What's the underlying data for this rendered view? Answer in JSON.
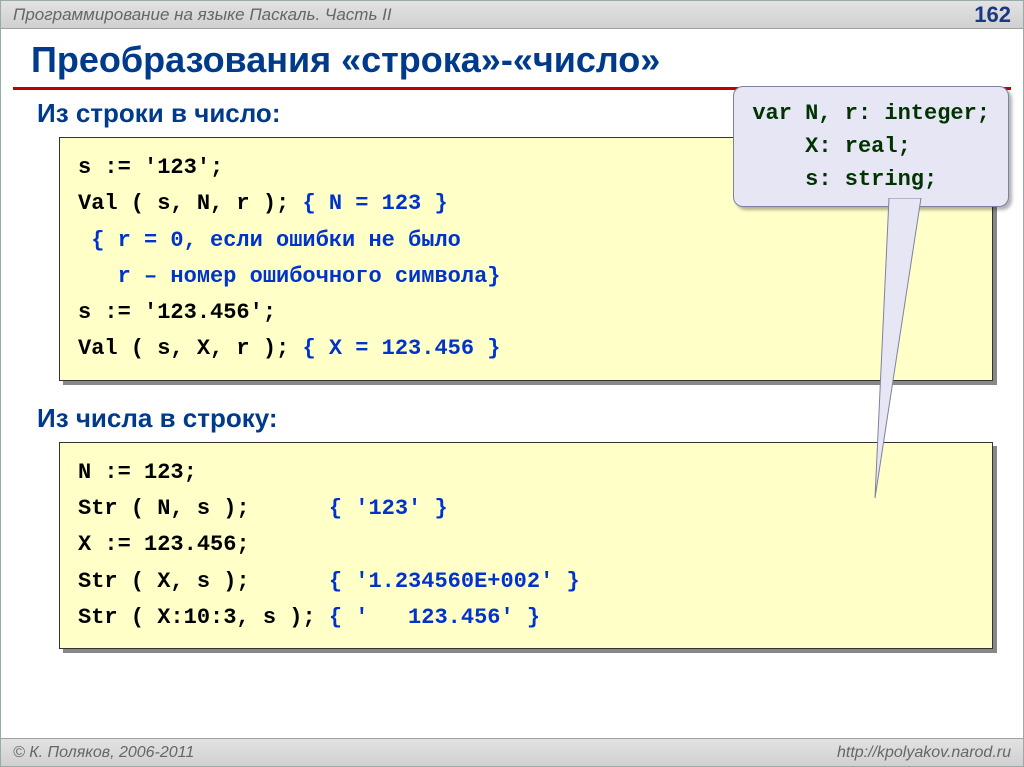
{
  "header": {
    "course": "Программирование на языке Паскаль. Часть II",
    "page": "162"
  },
  "title": "Преобразования «строка»-«число»",
  "callout": "var N, r: integer;\n    X: real;\n    s: string;",
  "section1": {
    "heading": "Из строки в число:",
    "code_l1a": "s := '123';",
    "code_l2a": "Val ( s, N, r ); ",
    "code_l2b": "{ N = 123 }",
    "code_l3": " { r = 0, если ошибки не было",
    "code_l4": "   r – номер ошибочного символа}",
    "code_l5": "s := '123.456';",
    "code_l6a": "Val ( s, X, r ); ",
    "code_l6b": "{ X = 123.456 }"
  },
  "section2": {
    "heading": "Из числа в строку:",
    "code_l1": "N := 123;",
    "code_l2a": "Str ( N, s );      ",
    "code_l2b": "{ '123' }",
    "code_l3": "X := 123.456;",
    "code_l4a": "Str ( X, s );      ",
    "code_l4b": "{ '1.234560E+002' }",
    "code_l5a": "Str ( X:10:3, s ); ",
    "code_l5b": "{ '   123.456' }"
  },
  "footer": {
    "copyright": "© К. Поляков, 2006-2011",
    "url": "http://kpolyakov.narod.ru"
  }
}
